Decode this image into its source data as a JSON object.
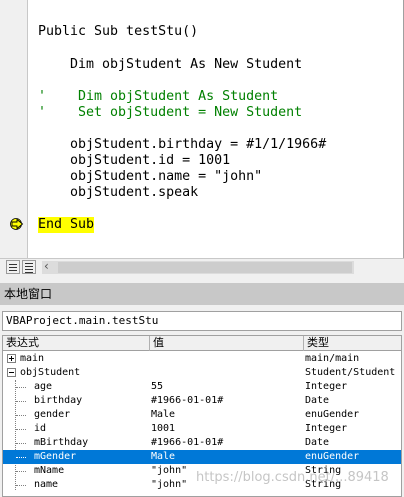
{
  "code": {
    "lines": [
      {
        "text": "Public Sub testStu()"
      },
      {
        "text": "    Dim objStudent As New Student"
      },
      {
        "text": "'    Dim objStudent As Student"
      },
      {
        "text": "'    Set objStudent = New Student"
      },
      {
        "text": "    objStudent.birthday = #1/1/1966#"
      },
      {
        "text": "    objStudent.id = 1001"
      },
      {
        "text": "    objStudent.name = \"john\""
      },
      {
        "text": "    objStudent.speak"
      },
      {
        "text": "End Sub"
      }
    ]
  },
  "locals": {
    "title": "本地窗口",
    "context": "VBAProject.main.testStu",
    "headers": {
      "expression": "表达式",
      "value": "值",
      "type": "类型"
    },
    "rows": [
      {
        "expression": "main",
        "value": "",
        "type": "main/main",
        "expander": "+"
      },
      {
        "expression": "objStudent",
        "value": "",
        "type": "Student/Student",
        "expander": "-"
      },
      {
        "expression": "age",
        "value": "55",
        "type": "Integer"
      },
      {
        "expression": "birthday",
        "value": "#1966-01-01#",
        "type": "Date"
      },
      {
        "expression": "gender",
        "value": "Male",
        "type": "enuGender"
      },
      {
        "expression": "id",
        "value": "1001",
        "type": "Integer"
      },
      {
        "expression": "mBirthday",
        "value": "#1966-01-01#",
        "type": "Date"
      },
      {
        "expression": "mGender",
        "value": "Male",
        "type": "enuGender",
        "selected": true
      },
      {
        "expression": "mName",
        "value": "\"john\"",
        "type": "String"
      },
      {
        "expression": "name",
        "value": "\"john\"",
        "type": "String"
      }
    ]
  },
  "watermark": "https://blog.csdn.net/...89418",
  "colors": {
    "comment": "#008000",
    "highlight": "#ffff00",
    "selection": "#0078d7"
  },
  "icons": {
    "execution_arrow": "arrow-right-icon",
    "procedure_view": "procedure-view-icon",
    "full_module_view": "full-module-view-icon"
  }
}
